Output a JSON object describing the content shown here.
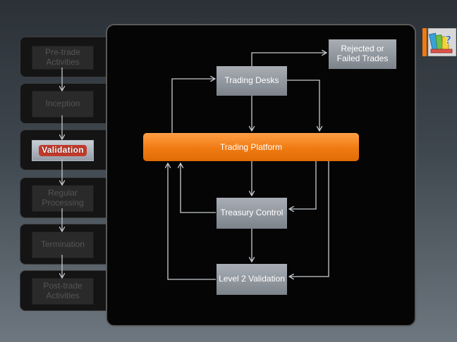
{
  "sidebar": {
    "steps": [
      {
        "label": "Pre-trade Activities",
        "active": false
      },
      {
        "label": "Inception",
        "active": false
      },
      {
        "label": "Validation",
        "active": true
      },
      {
        "label": "Regular Processing",
        "active": false
      },
      {
        "label": "Termination",
        "active": false
      },
      {
        "label": "Post-trade Activities",
        "active": false
      }
    ]
  },
  "diagram": {
    "trading_desks": "Trading Desks",
    "rejected": "Rejected or Failed Trades",
    "platform": "Trading Platform",
    "treasury": "Treasury Control",
    "level2": "Level 2 Validation"
  },
  "icon": {
    "name": "books-question-icon"
  },
  "colors": {
    "accent": "#f07a12",
    "box": "#8f959c",
    "highlight": "#c0392b"
  }
}
